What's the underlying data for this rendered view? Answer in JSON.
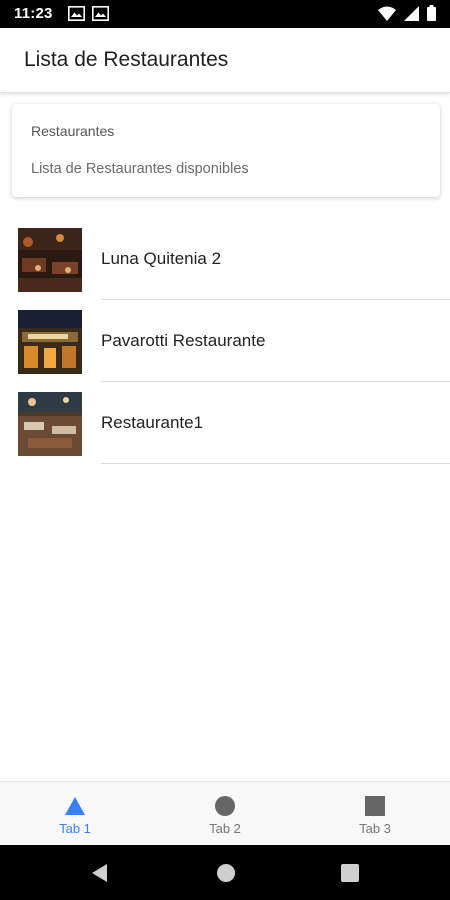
{
  "status_bar": {
    "time": "11:23",
    "icons": [
      "gallery-icon",
      "gallery-icon",
      "wifi-icon",
      "signal-icon",
      "battery-icon"
    ]
  },
  "app_bar": {
    "title": "Lista de Restaurantes"
  },
  "card": {
    "title": "Restaurantes",
    "subtitle": "Lista de Restaurantes disponibles"
  },
  "restaurants": [
    {
      "name": "Luna Quitenia 2"
    },
    {
      "name": "Pavarotti Restaurante"
    },
    {
      "name": "Restaurante1"
    }
  ],
  "tabs": [
    {
      "label": "Tab 1",
      "icon": "triangle-icon",
      "active": true
    },
    {
      "label": "Tab 2",
      "icon": "circle-icon",
      "active": false
    },
    {
      "label": "Tab 3",
      "icon": "square-icon",
      "active": false
    }
  ],
  "nav_bar": {
    "buttons": [
      "back-icon",
      "home-icon",
      "recents-icon"
    ]
  },
  "colors": {
    "accent": "#3880ff",
    "inactive_tab": "#777777",
    "status_bar": "#000000"
  }
}
